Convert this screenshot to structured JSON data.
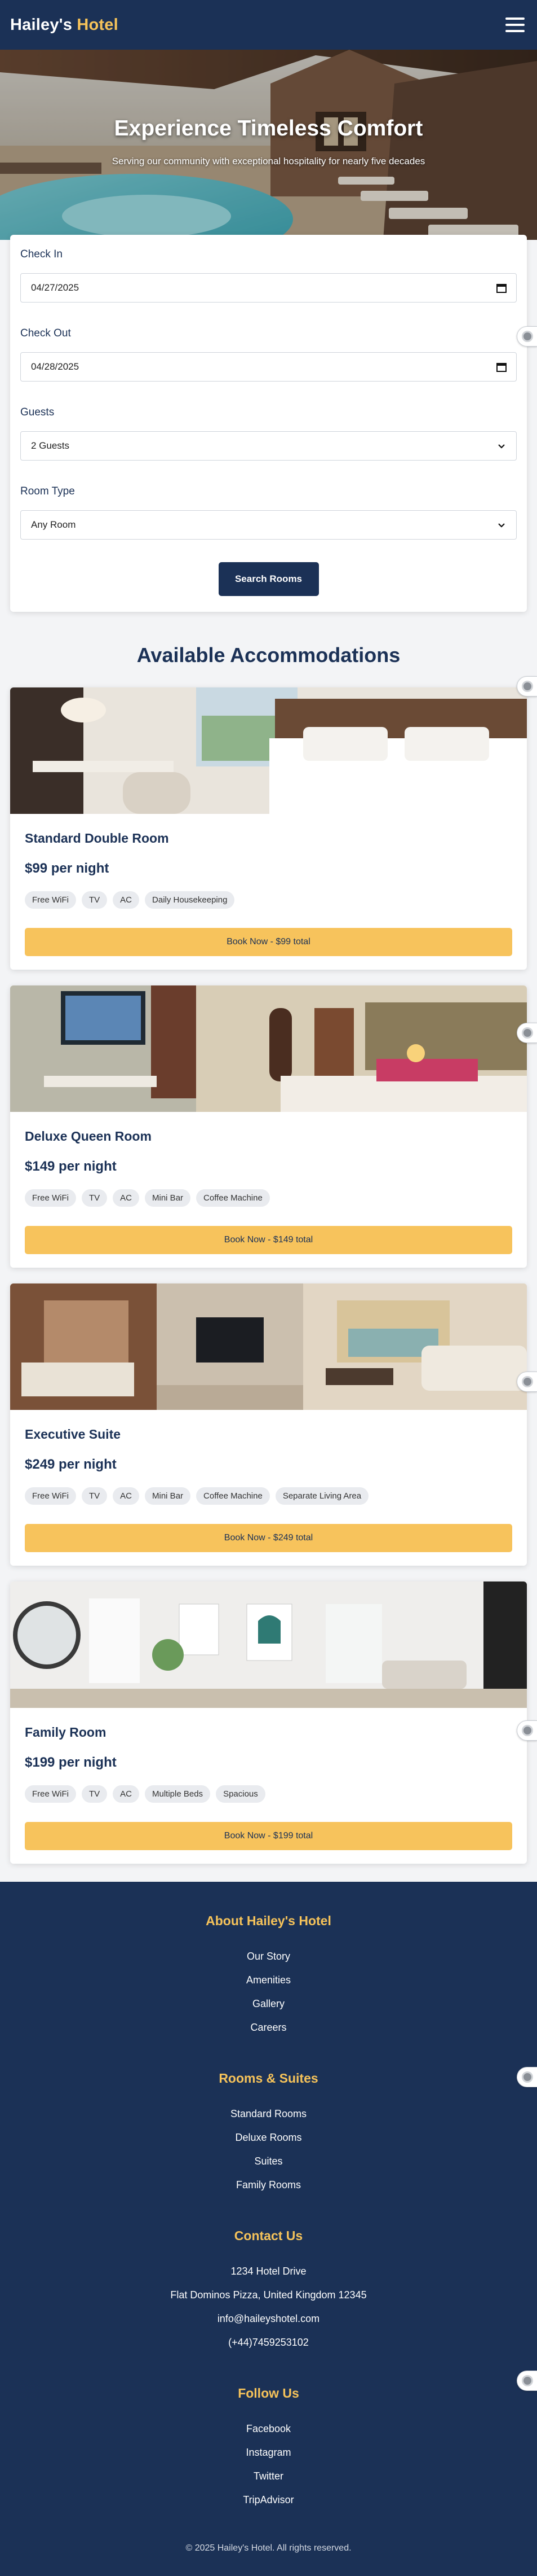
{
  "header": {
    "brand_prefix": "Hailey's",
    "brand_accent": "Hotel",
    "menu_icon": "hamburger-icon"
  },
  "hero": {
    "title": "Experience Timeless Comfort",
    "subtitle": "Serving our community with exceptional hospitality for nearly five decades"
  },
  "search": {
    "check_in_label": "Check In",
    "check_in_value": "04/27/2025",
    "check_out_label": "Check Out",
    "check_out_value": "04/28/2025",
    "guests_label": "Guests",
    "guests_value": "2 Guests",
    "room_type_label": "Room Type",
    "room_type_value": "Any Room",
    "button_label": "Search Rooms"
  },
  "rooms_section": {
    "title": "Available Accommodations"
  },
  "rooms": [
    {
      "name": "Standard Double Room",
      "price": "$99 per night",
      "amenities": [
        "Free WiFi",
        "TV",
        "AC",
        "Daily Housekeeping"
      ],
      "button": "Book Now - $99 total"
    },
    {
      "name": "Deluxe Queen Room",
      "price": "$149 per night",
      "amenities": [
        "Free WiFi",
        "TV",
        "AC",
        "Mini Bar",
        "Coffee Machine"
      ],
      "button": "Book Now - $149 total"
    },
    {
      "name": "Executive Suite",
      "price": "$249 per night",
      "amenities": [
        "Free WiFi",
        "TV",
        "AC",
        "Mini Bar",
        "Coffee Machine",
        "Separate Living Area"
      ],
      "button": "Book Now - $249 total"
    },
    {
      "name": "Family Room",
      "price": "$199 per night",
      "amenities": [
        "Free WiFi",
        "TV",
        "AC",
        "Multiple Beds",
        "Spacious"
      ],
      "button": "Book Now - $199 total"
    }
  ],
  "footer": {
    "about": {
      "heading": "About Hailey's Hotel",
      "links": [
        "Our Story",
        "Amenities",
        "Gallery",
        "Careers"
      ]
    },
    "rooms": {
      "heading": "Rooms & Suites",
      "links": [
        "Standard Rooms",
        "Deluxe Rooms",
        "Suites",
        "Family Rooms"
      ]
    },
    "contact": {
      "heading": "Contact Us",
      "lines": [
        "1234 Hotel Drive",
        "Flat Dominos Pizza, United Kingdom 12345",
        "info@haileyshotel.com",
        "(+44)7459253102"
      ]
    },
    "follow": {
      "heading": "Follow Us",
      "links": [
        "Facebook",
        "Instagram",
        "Twitter",
        "TripAdvisor"
      ]
    },
    "copyright": "© 2025 Hailey's Hotel. All rights reserved."
  },
  "colors": {
    "navy": "#1b3156",
    "gold": "#f6c35a",
    "button_gold": "#f7c35c"
  }
}
